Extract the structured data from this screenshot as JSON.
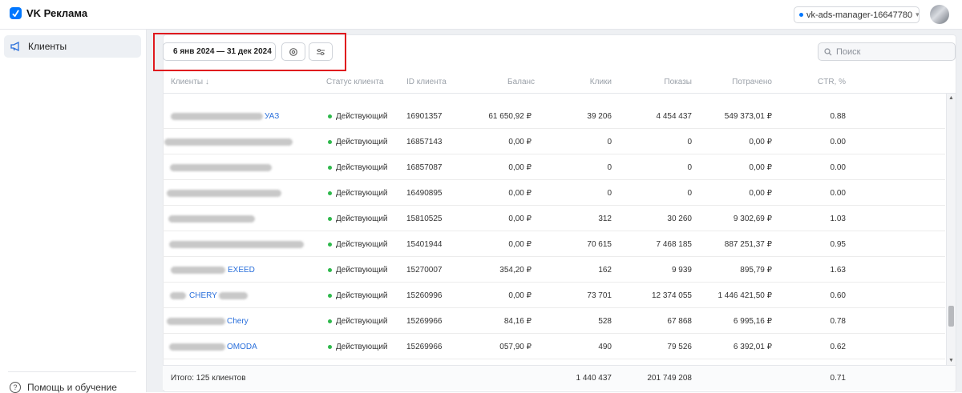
{
  "app": {
    "title": "VK Реклама"
  },
  "account": {
    "name": "vk-ads-manager-16647780"
  },
  "sidebar": {
    "items": [
      {
        "label": "Клиенты"
      }
    ],
    "help_label": "Помощь и обучение"
  },
  "toolbar": {
    "date_range": "6 янв 2024 — 31 дек 2024",
    "search_placeholder": "Поиск"
  },
  "table": {
    "columns": [
      "Клиенты ↓",
      "Статус клиента",
      "ID клиента",
      "Баланс",
      "Клики",
      "Показы",
      "Потрачено",
      "CTR, %"
    ],
    "rows": [
      {
        "name": "УАЗ",
        "status": "Действующий",
        "id": "16901357",
        "balance": "61 650,92 ₽",
        "clicks": "39 206",
        "shows": "4 454 437",
        "spent": "549 373,01 ₽",
        "ctr": "0.88"
      },
      {
        "name": "",
        "status": "Действующий",
        "id": "16857143",
        "balance": "0,00 ₽",
        "clicks": "0",
        "shows": "0",
        "spent": "0,00 ₽",
        "ctr": "0.00"
      },
      {
        "name": "",
        "status": "Действующий",
        "id": "16857087",
        "balance": "0,00 ₽",
        "clicks": "0",
        "shows": "0",
        "spent": "0,00 ₽",
        "ctr": "0.00"
      },
      {
        "name": "",
        "status": "Действующий",
        "id": "16490895",
        "balance": "0,00 ₽",
        "clicks": "0",
        "shows": "0",
        "spent": "0,00 ₽",
        "ctr": "0.00"
      },
      {
        "name": "",
        "status": "Действующий",
        "id": "15810525",
        "balance": "0,00 ₽",
        "clicks": "312",
        "shows": "30 260",
        "spent": "9 302,69 ₽",
        "ctr": "1.03"
      },
      {
        "name": "",
        "status": "Действующий",
        "id": "15401944",
        "balance": "0,00 ₽",
        "clicks": "70 615",
        "shows": "7 468 185",
        "spent": "887 251,37 ₽",
        "ctr": "0.95"
      },
      {
        "name": "EXEED",
        "status": "Действующий",
        "id": "15270007",
        "balance": "354,20 ₽",
        "clicks": "162",
        "shows": "9 939",
        "spent": "895,79 ₽",
        "ctr": "1.63"
      },
      {
        "name": "CHERY",
        "status": "Действующий",
        "id": "15260996",
        "balance": "0,00 ₽",
        "clicks": "73 701",
        "shows": "12 374 055",
        "spent": "1 446 421,50 ₽",
        "ctr": "0.60"
      },
      {
        "name": "Chery",
        "status": "Действующий",
        "id": "15269966",
        "balance": "84,16 ₽",
        "clicks": "528",
        "shows": "67 868",
        "spent": "6 995,16 ₽",
        "ctr": "0.78"
      },
      {
        "name": "OMODA",
        "status": "Действующий",
        "id": "15269966",
        "balance": "057,90 ₽",
        "clicks": "490",
        "shows": "79 526",
        "spent": "6 392,01 ₽",
        "ctr": "0.62"
      }
    ],
    "footer": {
      "label": "Итого: 125 клиентов",
      "clicks": "1 440 437",
      "shows": "201 749 208",
      "ctr": "0.71"
    }
  }
}
